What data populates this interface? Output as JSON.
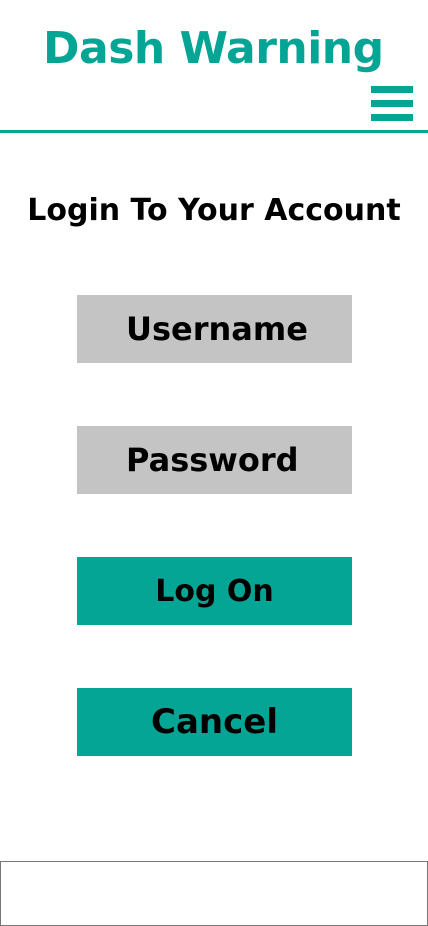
{
  "header": {
    "title": "Dash Warning",
    "menu_icon": "hamburger-menu-icon"
  },
  "login": {
    "heading": "Login To Your Account",
    "username_placeholder": "Username",
    "username_value": "",
    "password_placeholder": "Password",
    "password_value": "",
    "logon_label": "Log On",
    "cancel_label": "Cancel"
  },
  "colors": {
    "accent": "#05a595",
    "field_background": "#c4c4c4",
    "text": "#000000",
    "background": "#ffffff"
  }
}
